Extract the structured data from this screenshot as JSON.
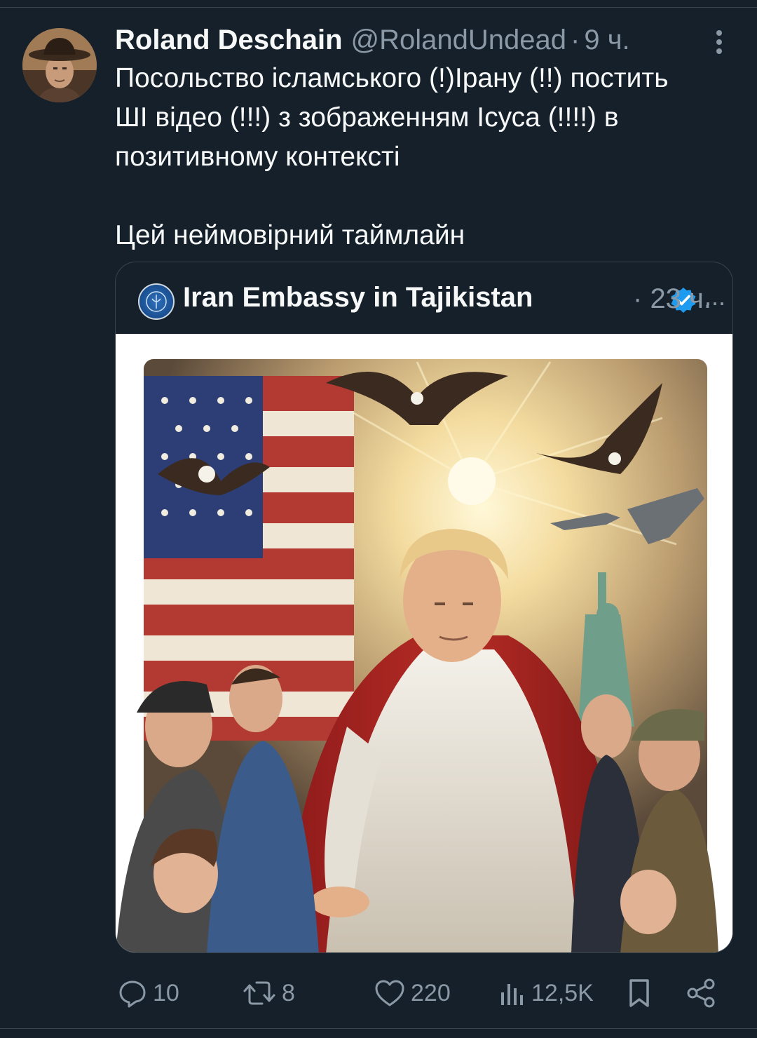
{
  "tweet": {
    "display_name": "Roland Deschain",
    "handle": "@RolandUndead",
    "separator": "·",
    "time": "9 ч.",
    "text_line1": "Посольство ісламського (!)Ірану (!!) постить",
    "text_line2": "ШІ відео (!!!) з зображенням Ісуса (!!!!) в",
    "text_line3": "позитивному контексті",
    "text_line4": "Цей неймовірний таймлайн"
  },
  "quote": {
    "name": "Iran Embassy in Tajikistan",
    "ellipsis": "...",
    "separator": "·",
    "time": "23 ч.",
    "verified_color": "#1d9bf0",
    "media_icon": "mute-icon"
  },
  "actions": {
    "replies": "10",
    "reposts": "8",
    "likes": "220",
    "views": "12,5K"
  },
  "icons": {
    "more": "more-vertical-icon",
    "reply": "reply-icon",
    "repost": "repost-icon",
    "like": "heart-icon",
    "views": "views-icon",
    "bookmark": "bookmark-icon",
    "share": "share-icon"
  },
  "colors": {
    "background": "#15202b",
    "text": "#f7f9f9",
    "secondary": "#8b98a5",
    "border": "#38444d"
  }
}
